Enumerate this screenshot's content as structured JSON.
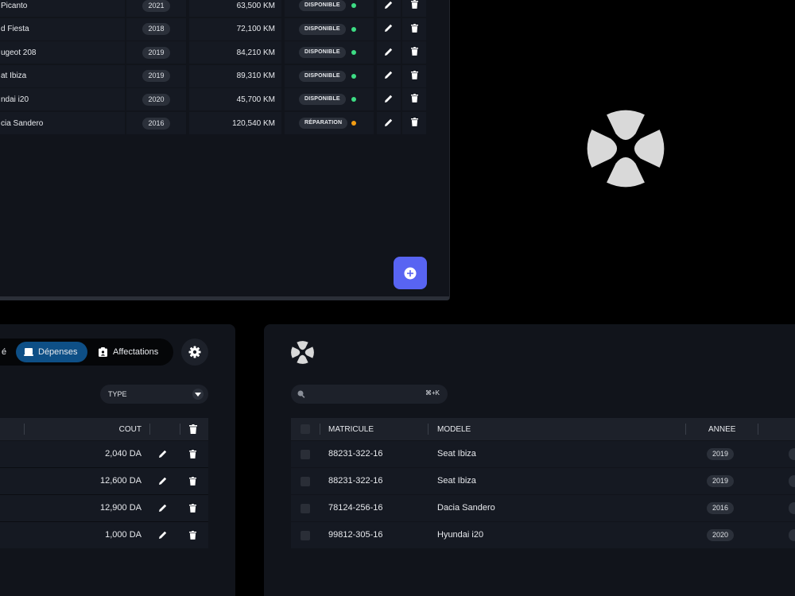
{
  "vehicles_table": {
    "rows": [
      {
        "model": "Picanto",
        "year": "2021",
        "mileage": "63,500 KM",
        "status": "DISPONIBLE",
        "status_color": "#3ddc84"
      },
      {
        "model": "d Fiesta",
        "year": "2018",
        "mileage": "72,100 KM",
        "status": "DISPONIBLE",
        "status_color": "#3ddc84"
      },
      {
        "model": "ugeot 208",
        "year": "2019",
        "mileage": "84,210 KM",
        "status": "DISPONIBLE",
        "status_color": "#3ddc84"
      },
      {
        "model": "at Ibiza",
        "year": "2019",
        "mileage": "89,310 KM",
        "status": "DISPONIBLE",
        "status_color": "#3ddc84"
      },
      {
        "model": "ndai i20",
        "year": "2020",
        "mileage": "45,700 KM",
        "status": "DISPONIBLE",
        "status_color": "#3ddc84"
      },
      {
        "model": "cia Sandero",
        "year": "2016",
        "mileage": "120,540 KM",
        "status": "RÉPARATION",
        "status_color": "#f39c12"
      }
    ],
    "fab_icon": "plus-circle-icon",
    "accent_color": "#5864f2"
  },
  "expenses_panel": {
    "tabs": [
      {
        "label": "é",
        "icon": "",
        "active": false
      },
      {
        "label": "Dépenses",
        "icon": "receipt-icon",
        "active": true
      },
      {
        "label": "Affectations",
        "icon": "clipboard-user-icon",
        "active": false
      }
    ],
    "settings_icon": "gear-icon",
    "type_select": {
      "value": "TYPE"
    },
    "columns": {
      "cost": "COUT"
    },
    "rows": [
      {
        "cost": "2,040 DA"
      },
      {
        "cost": "12,600 DA"
      },
      {
        "cost": "12,900 DA"
      },
      {
        "cost": "1,000 DA"
      }
    ],
    "active_tab_color": "#0e4f86"
  },
  "assignments_panel": {
    "search": {
      "placeholder": "",
      "shortcut": "⌘+K"
    },
    "columns": {
      "plate": "MATRICULE",
      "model": "MODELE",
      "year": "ANNEE"
    },
    "rows": [
      {
        "plate": "88231-322-16",
        "model": "Seat Ibiza",
        "year": "2019"
      },
      {
        "plate": "88231-322-16",
        "model": "Seat Ibiza",
        "year": "2019"
      },
      {
        "plate": "78124-256-16",
        "model": "Dacia Sandero",
        "year": "2016"
      },
      {
        "plate": "99812-305-16",
        "model": "Hyundai i20",
        "year": "2020"
      }
    ]
  }
}
